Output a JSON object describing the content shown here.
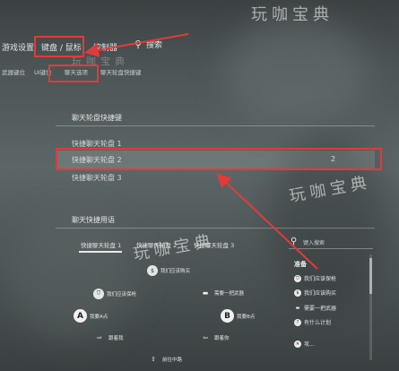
{
  "watermark": "玩咖宝典",
  "nav": {
    "tabs": [
      {
        "label": "游戏设置"
      },
      {
        "label": "键盘 / 鼠标"
      },
      {
        "label": "控制器"
      }
    ],
    "search_label": "搜索",
    "subtabs": [
      {
        "label": "武器键位"
      },
      {
        "label": "UI键位"
      },
      {
        "label": "聊天选项"
      },
      {
        "label": "聊天轮盘快捷键"
      }
    ]
  },
  "hotkeys": {
    "title": "聊天轮盘快捷键",
    "rows": [
      {
        "label": "快捷聊天轮盘 1",
        "value": ""
      },
      {
        "label": "快捷聊天轮盘 2",
        "value": "2"
      },
      {
        "label": "快捷聊天轮盘 3",
        "value": ""
      }
    ]
  },
  "phrases": {
    "title": "聊天快捷用语",
    "wheel_tabs": [
      {
        "label": "快捷聊天轮盘 1"
      },
      {
        "label": "快捷聊天轮盘 2"
      },
      {
        "label": "快捷聊天轮盘 3"
      }
    ],
    "search_placeholder": "键入搜索",
    "slots": {
      "top": "我们应该购买",
      "upper_left": "我们应该保枪",
      "upper_right": "需要一把武器",
      "left": "我要A点",
      "right": "我要B点",
      "lower_left": "跟着我",
      "lower_right": "跟着你",
      "bottom": "前往中路"
    },
    "list_header": "准备",
    "list_items": [
      {
        "label": "我们应该保枪"
      },
      {
        "label": "我们应该购买"
      },
      {
        "label": "需要一把武器"
      },
      {
        "label": "有什么计划"
      },
      {
        "label": "攻..."
      }
    ]
  },
  "colors": {
    "highlight": "#e23a3a",
    "accent_line": "#eaeaea"
  }
}
